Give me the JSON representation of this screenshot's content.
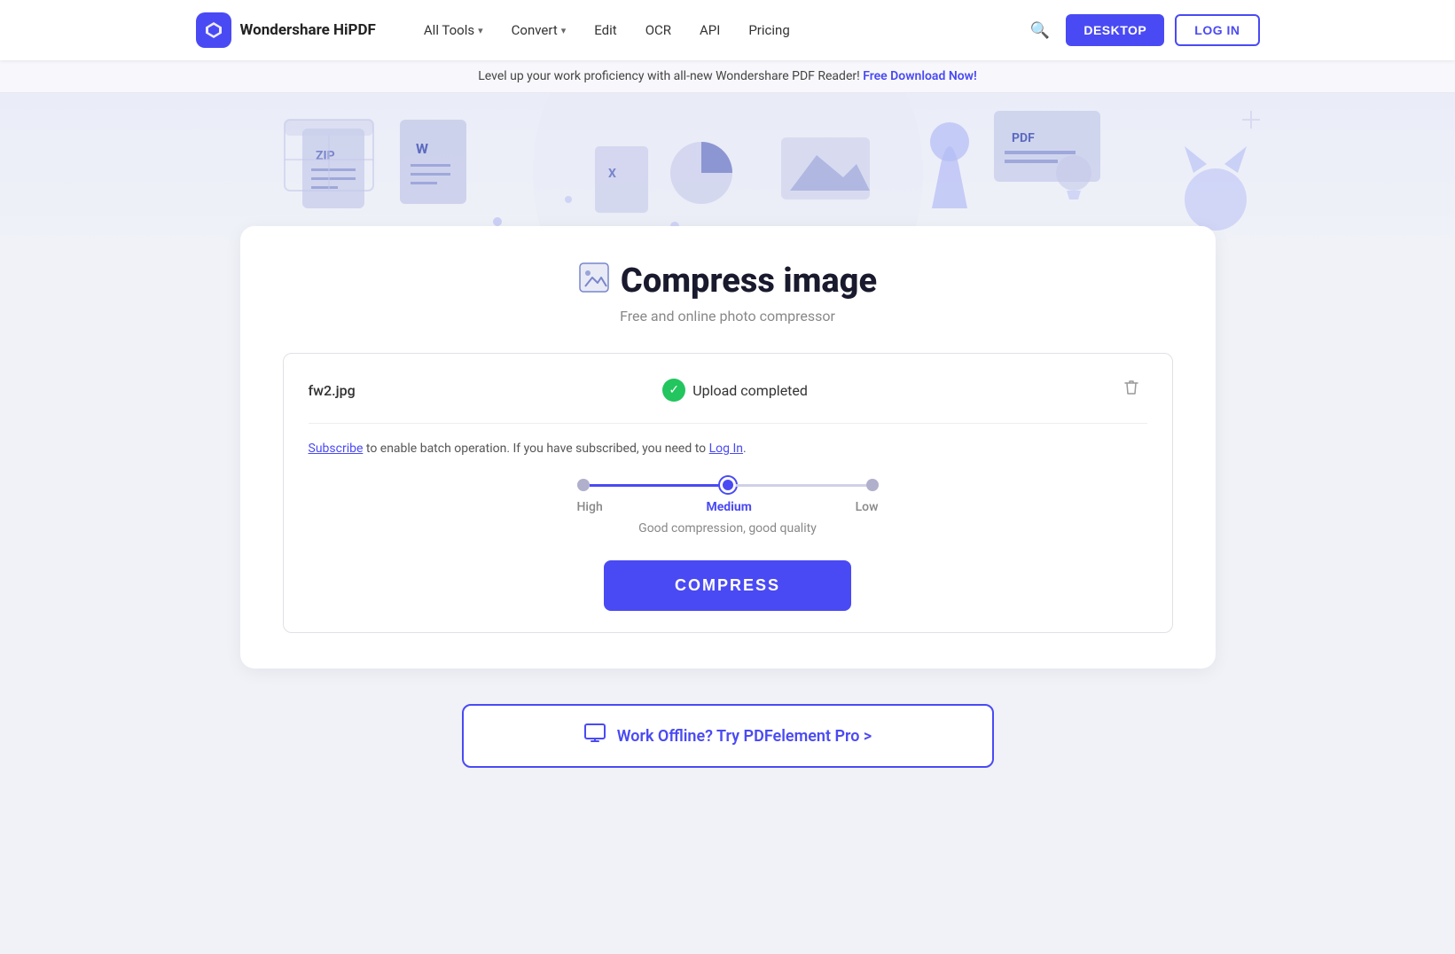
{
  "brand": {
    "name": "Wondershare HiPDF",
    "logo_char": "◇"
  },
  "nav": {
    "items": [
      {
        "label": "All Tools",
        "has_dropdown": true
      },
      {
        "label": "Convert",
        "has_dropdown": true
      },
      {
        "label": "Edit",
        "has_dropdown": false
      },
      {
        "label": "OCR",
        "has_dropdown": false
      },
      {
        "label": "API",
        "has_dropdown": false
      },
      {
        "label": "Pricing",
        "has_dropdown": false
      }
    ],
    "desktop_btn": "DESKTOP",
    "login_btn": "LOG IN"
  },
  "banner": {
    "text": "Level up your work proficiency with all-new Wondershare PDF Reader!",
    "link_text": "Free Download Now!"
  },
  "page": {
    "title": "Compress image",
    "subtitle": "Free and online photo compressor",
    "title_icon": "🖼"
  },
  "upload": {
    "file_name": "fw2.jpg",
    "status_text": "Upload completed",
    "subscribe_prefix": "to enable batch operation. If you have subscribed, you need to",
    "subscribe_link": "Subscribe",
    "login_link": "Log In"
  },
  "compression": {
    "levels": [
      "High",
      "Medium",
      "Low"
    ],
    "selected": "Medium",
    "selected_index": 1,
    "description": "Good compression, good quality",
    "compress_btn": "COMPRESS"
  },
  "offline_cta": {
    "label": "Work Offline? Try PDFelement Pro >"
  }
}
